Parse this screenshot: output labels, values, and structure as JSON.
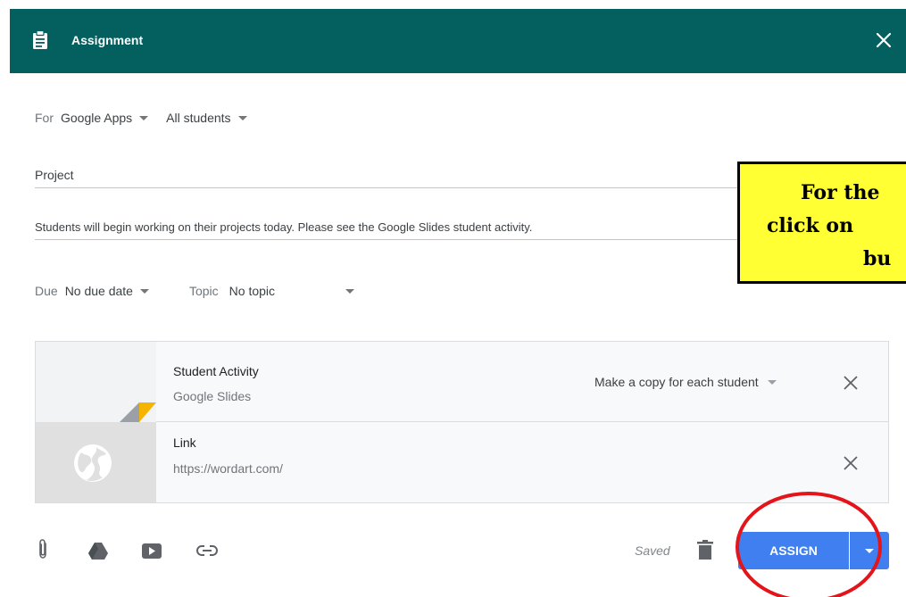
{
  "header": {
    "title": "Assignment",
    "bg_color": "#045f5f",
    "icon": "clipboard-icon",
    "close_icon": "close-icon"
  },
  "for_row": {
    "label": "For",
    "class_value": "Google Apps",
    "students_value": "All students"
  },
  "title_field": {
    "value": "Project"
  },
  "instructions_field": {
    "value": "Students will begin working on their projects today.  Please see the Google Slides student activity."
  },
  "due_row": {
    "due_label": "Due",
    "due_value": "No due date",
    "topic_label": "Topic",
    "topic_value": "No topic"
  },
  "callout": {
    "line1": "For the",
    "line2": "click on",
    "line3": "bu",
    "bg_color": "#ffff33"
  },
  "attachments": [
    {
      "title": "Student Activity",
      "subtitle": "Google Slides",
      "option": "Make a copy for each student",
      "thumb_icon": "slides-thumbnail-icon"
    },
    {
      "title": "Link",
      "subtitle": "https://wordart.com/",
      "thumb_icon": "globe-icon"
    }
  ],
  "toolbar": {
    "icons": [
      "paperclip-icon",
      "google-drive-icon",
      "youtube-icon",
      "link-icon"
    ],
    "saved_text": "Saved",
    "assign_label": "ASSIGN",
    "accent_color": "#3f7ff0",
    "annotation_color": "#e4141b"
  }
}
